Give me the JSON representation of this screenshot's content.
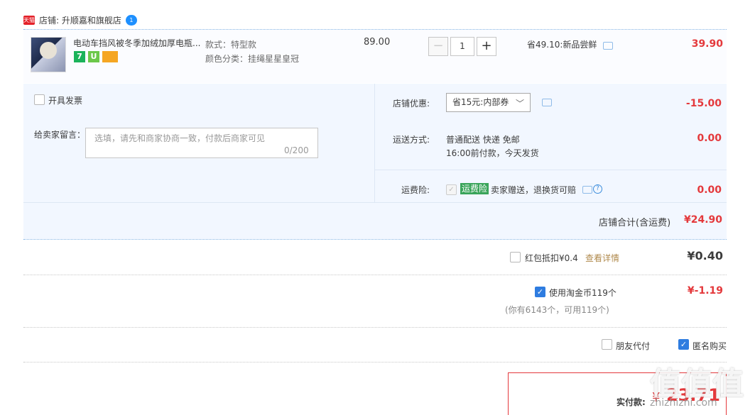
{
  "shop": {
    "badge": "天猫",
    "label": "店铺: 升顺嘉和旗舰店",
    "ww_badge": "1"
  },
  "item": {
    "title": "电动车挡风被冬季加绒加厚电瓶...",
    "services": [
      "7",
      "U",
      ""
    ],
    "spec_style": "款式：特型款",
    "spec_color": "颜色分类：挂绳星星皇冠",
    "unit_price": "89.00",
    "qty_minus": "−",
    "qty": "1",
    "qty_plus": "+",
    "save_text": "省49.10:新品尝鲜",
    "total": "39.90"
  },
  "options": {
    "invoice_label": "开具发票",
    "message_label": "给卖家留言：",
    "message_placeholder": "选填，请先和商家协商一致，付款后商家可见",
    "message_count": "0/200",
    "discount_label": "店铺优惠:",
    "discount_select": "省15元:内部券",
    "discount_value": "-15.00",
    "shipping_label": "运送方式:",
    "shipping_line1": "普通配送 快递 免邮",
    "shipping_line2": "16:00前付款，今天发货",
    "shipping_value": "0.00",
    "insurance_label": "运费险:",
    "insurance_tag": "运费险",
    "insurance_text": "卖家赠送，退换货可赔",
    "insurance_value": "0.00",
    "shop_total_label": "店铺合计(含运费)",
    "shop_total_value": "¥24.90"
  },
  "summary": {
    "hongbao_label": "红包抵扣¥0.4",
    "hongbao_link": "查看详情",
    "hongbao_value": "¥0.40",
    "coin_label": "使用淘金币119个",
    "coin_value": "¥-1.19",
    "coin_note": "(你有6143个，可用119个)",
    "friend_pay_label": "朋友代付",
    "anonymous_label": "匿名购买",
    "pay_label": "实付款:",
    "pay_currency": "¥",
    "pay_value": "23.71"
  },
  "watermark": {
    "main": "值值值",
    "sub": "zhizhizhi.com"
  },
  "colors": {
    "accent_red": "#e4393c",
    "accent_blue": "#2e7ce0",
    "panel_bg": "#f2f7ff"
  }
}
